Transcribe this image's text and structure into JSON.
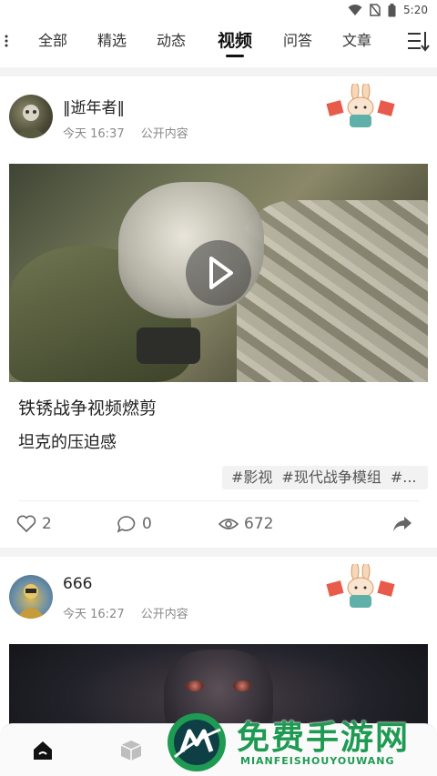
{
  "status_bar": {
    "time": "5:20"
  },
  "tabs": {
    "items": [
      {
        "label": "全部"
      },
      {
        "label": "精选"
      },
      {
        "label": "动态"
      },
      {
        "label": "视频"
      },
      {
        "label": "问答"
      },
      {
        "label": "文章"
      }
    ],
    "active": "视频"
  },
  "posts": [
    {
      "username": "‖逝年者‖",
      "time": "今天 16:37",
      "scope": "公开内容",
      "title": "铁锈战争视频燃剪",
      "subtitle": "坦克的压迫感",
      "tags": [
        "#影视",
        "#现代战争模组",
        "#..."
      ],
      "likes": "2",
      "comments": "0",
      "views": "672"
    },
    {
      "username": "666",
      "time": "今天 16:27",
      "scope": "公开内容"
    }
  ],
  "watermark": {
    "title": "免费手游网",
    "subtitle": "MIANFEISHOUYOUWANG"
  },
  "colors": {
    "watermark_green": "#1f9a52",
    "active_tab": "#111111",
    "muted_text": "#888888"
  }
}
